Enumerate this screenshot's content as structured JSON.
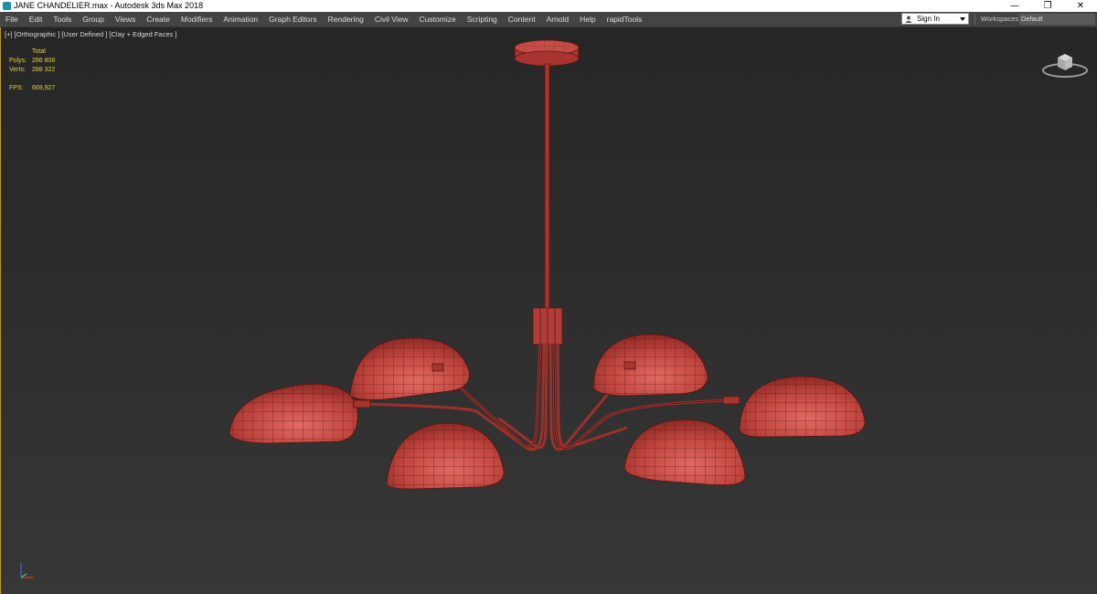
{
  "window": {
    "title": "JANE CHANDELIER.max - Autodesk 3ds Max 2018",
    "minimize": "—",
    "restore": "❐",
    "close": "✕"
  },
  "menu": {
    "items": [
      "File",
      "Edit",
      "Tools",
      "Group",
      "Views",
      "Create",
      "Modifiers",
      "Animation",
      "Graph Editors",
      "Rendering",
      "Civil View",
      "Customize",
      "Scripting",
      "Content",
      "Arnold",
      "Help",
      "rapidTools"
    ],
    "signin_label": "Sign In",
    "workspaces_label": "Workspaces:",
    "workspace_value": "Default"
  },
  "viewport": {
    "label": "[+] [Orthographic ] [User Defined ] [Clay + Edged Faces ]",
    "stats": {
      "total_label": "Total",
      "polys_label": "Polys:",
      "polys_value": "286 808",
      "verts_label": "Verts:",
      "verts_value": "288 322",
      "fps_label": "FPS:",
      "fps_value": "669,927"
    },
    "model_color": "#b4403c",
    "wire_color": "#5a1411",
    "background_top": "#262626",
    "background_bottom": "#373737"
  },
  "icons": {
    "app": "3dsmax-app-icon",
    "user": "user-icon",
    "viewcube": "viewcube-icon",
    "axis": "axis-tripod-icon"
  }
}
